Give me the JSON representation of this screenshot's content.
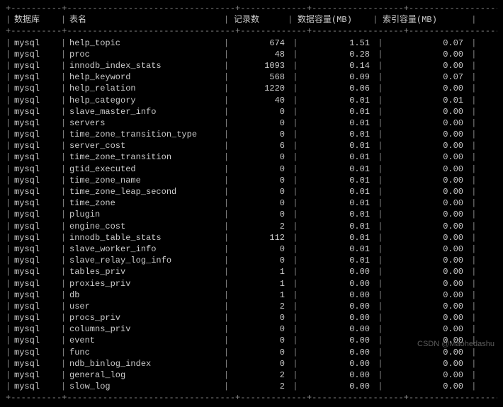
{
  "headers": {
    "db": "数据库",
    "table": "表名",
    "records": "记录数",
    "data_mb": "数据容量(MB)",
    "index_mb": "索引容量(MB)"
  },
  "divider_char": "-",
  "pipe_char": "|",
  "cross_char": "+",
  "rows": [
    {
      "db": "mysql",
      "table": "help_topic",
      "records": "674",
      "data_mb": "1.51",
      "index_mb": "0.07"
    },
    {
      "db": "mysql",
      "table": "proc",
      "records": "48",
      "data_mb": "0.28",
      "index_mb": "0.00"
    },
    {
      "db": "mysql",
      "table": "innodb_index_stats",
      "records": "1093",
      "data_mb": "0.14",
      "index_mb": "0.00"
    },
    {
      "db": "mysql",
      "table": "help_keyword",
      "records": "568",
      "data_mb": "0.09",
      "index_mb": "0.07"
    },
    {
      "db": "mysql",
      "table": "help_relation",
      "records": "1220",
      "data_mb": "0.06",
      "index_mb": "0.00"
    },
    {
      "db": "mysql",
      "table": "help_category",
      "records": "40",
      "data_mb": "0.01",
      "index_mb": "0.01"
    },
    {
      "db": "mysql",
      "table": "slave_master_info",
      "records": "0",
      "data_mb": "0.01",
      "index_mb": "0.00"
    },
    {
      "db": "mysql",
      "table": "servers",
      "records": "0",
      "data_mb": "0.01",
      "index_mb": "0.00"
    },
    {
      "db": "mysql",
      "table": "time_zone_transition_type",
      "records": "0",
      "data_mb": "0.01",
      "index_mb": "0.00"
    },
    {
      "db": "mysql",
      "table": "server_cost",
      "records": "6",
      "data_mb": "0.01",
      "index_mb": "0.00"
    },
    {
      "db": "mysql",
      "table": "time_zone_transition",
      "records": "0",
      "data_mb": "0.01",
      "index_mb": "0.00"
    },
    {
      "db": "mysql",
      "table": "gtid_executed",
      "records": "0",
      "data_mb": "0.01",
      "index_mb": "0.00"
    },
    {
      "db": "mysql",
      "table": "time_zone_name",
      "records": "0",
      "data_mb": "0.01",
      "index_mb": "0.00"
    },
    {
      "db": "mysql",
      "table": "time_zone_leap_second",
      "records": "0",
      "data_mb": "0.01",
      "index_mb": "0.00"
    },
    {
      "db": "mysql",
      "table": "time_zone",
      "records": "0",
      "data_mb": "0.01",
      "index_mb": "0.00"
    },
    {
      "db": "mysql",
      "table": "plugin",
      "records": "0",
      "data_mb": "0.01",
      "index_mb": "0.00"
    },
    {
      "db": "mysql",
      "table": "engine_cost",
      "records": "2",
      "data_mb": "0.01",
      "index_mb": "0.00"
    },
    {
      "db": "mysql",
      "table": "innodb_table_stats",
      "records": "112",
      "data_mb": "0.01",
      "index_mb": "0.00"
    },
    {
      "db": "mysql",
      "table": "slave_worker_info",
      "records": "0",
      "data_mb": "0.01",
      "index_mb": "0.00"
    },
    {
      "db": "mysql",
      "table": "slave_relay_log_info",
      "records": "0",
      "data_mb": "0.01",
      "index_mb": "0.00"
    },
    {
      "db": "mysql",
      "table": "tables_priv",
      "records": "1",
      "data_mb": "0.00",
      "index_mb": "0.00"
    },
    {
      "db": "mysql",
      "table": "proxies_priv",
      "records": "1",
      "data_mb": "0.00",
      "index_mb": "0.00"
    },
    {
      "db": "mysql",
      "table": "db",
      "records": "1",
      "data_mb": "0.00",
      "index_mb": "0.00"
    },
    {
      "db": "mysql",
      "table": "user",
      "records": "2",
      "data_mb": "0.00",
      "index_mb": "0.00"
    },
    {
      "db": "mysql",
      "table": "procs_priv",
      "records": "0",
      "data_mb": "0.00",
      "index_mb": "0.00"
    },
    {
      "db": "mysql",
      "table": "columns_priv",
      "records": "0",
      "data_mb": "0.00",
      "index_mb": "0.00"
    },
    {
      "db": "mysql",
      "table": "event",
      "records": "0",
      "data_mb": "0.00",
      "index_mb": "0.00"
    },
    {
      "db": "mysql",
      "table": "func",
      "records": "0",
      "data_mb": "0.00",
      "index_mb": "0.00"
    },
    {
      "db": "mysql",
      "table": "ndb_binlog_index",
      "records": "0",
      "data_mb": "0.00",
      "index_mb": "0.00"
    },
    {
      "db": "mysql",
      "table": "general_log",
      "records": "2",
      "data_mb": "0.00",
      "index_mb": "0.00"
    },
    {
      "db": "mysql",
      "table": "slow_log",
      "records": "2",
      "data_mb": "0.00",
      "index_mb": "0.00"
    }
  ],
  "watermark": "CSDN @Maohedashu"
}
